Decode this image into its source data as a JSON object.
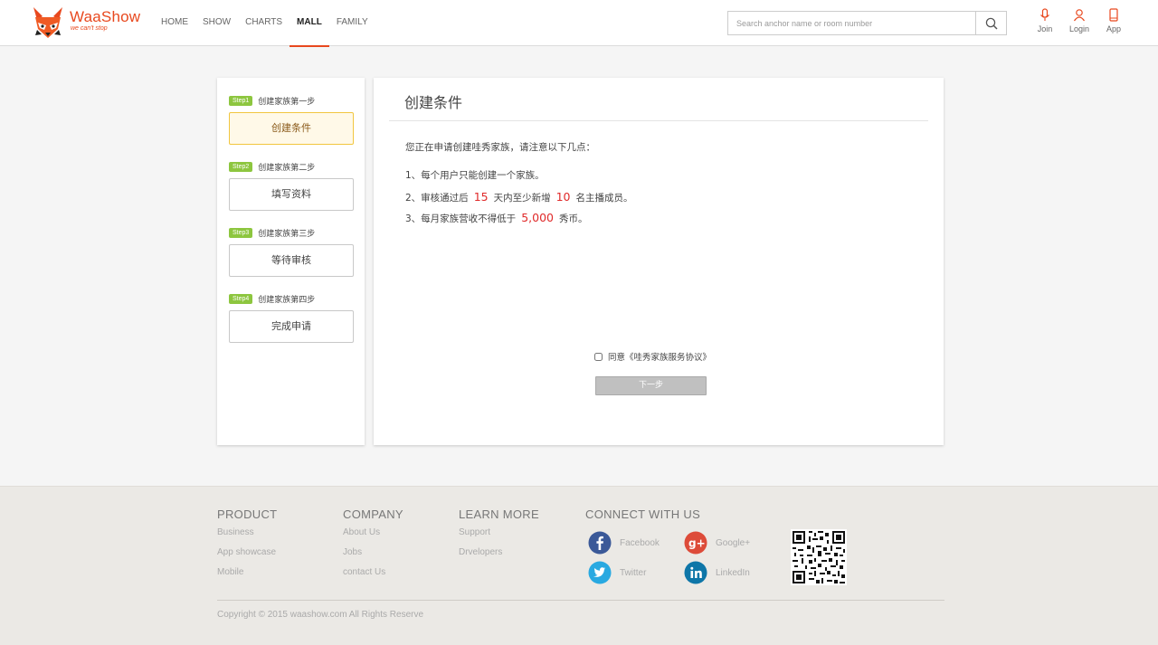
{
  "header": {
    "logo": {
      "title": "WaaShow",
      "slogan": "we can't stop"
    },
    "nav": [
      "HOME",
      "SHOW",
      "CHARTS",
      "MALL",
      "FAMILY"
    ],
    "nav_active": "MALL",
    "search": {
      "placeholder": "Search anchor name or room number"
    },
    "actions": [
      {
        "label": "Join",
        "icon": "microphone-icon"
      },
      {
        "label": "Login",
        "icon": "user-icon"
      },
      {
        "label": "App",
        "icon": "phone-icon"
      }
    ],
    "accent_color": "#e8481e"
  },
  "sidebar": {
    "steps": [
      {
        "badge": "Step1",
        "title": "创建家族第一步",
        "button": "创建条件",
        "active": true
      },
      {
        "badge": "Step2",
        "title": "创建家族第二步",
        "button": "填写资料",
        "active": false
      },
      {
        "badge": "Step3",
        "title": "创建家族第三步",
        "button": "等待审核",
        "active": false
      },
      {
        "badge": "Step4",
        "title": "创建家族第四步",
        "button": "完成申请",
        "active": false
      }
    ]
  },
  "content": {
    "title": "创建条件",
    "intro": "您正在申请创建哇秀家族，请注意以下几点：",
    "rule1": "1、每个用户只能创建一个家族。",
    "rule2": {
      "prefix": "2、审核通过后",
      "days": "15",
      "middle": "天内至少新增",
      "count": "10",
      "suffix": "名主播成员。"
    },
    "rule3": {
      "prefix": "3、每月家族营收不得低于",
      "amount": "5,000",
      "suffix": "秀币。"
    },
    "agree_label": "同意《哇秀家族服务协议》",
    "agree_checked": false,
    "next_button": "下一步",
    "highlight_color": "#e02a2a"
  },
  "footer": {
    "product": {
      "title": "PRODUCT",
      "links": [
        "Business",
        "App showcase",
        "Mobile"
      ]
    },
    "company": {
      "title": "COMPANY",
      "links": [
        "About Us",
        "Jobs",
        "contact Us"
      ]
    },
    "learn": {
      "title": "LEARN MORE",
      "links": [
        "Support",
        "Drvelopers"
      ]
    },
    "connect": {
      "title": "CONNECT WITH US",
      "facebook": "Facebook",
      "google": "Google+",
      "twitter": "Twitter",
      "linkedin": "LinkedIn"
    },
    "copyright": "Copyright © 2015 waashow.com All Rights Reserve"
  }
}
